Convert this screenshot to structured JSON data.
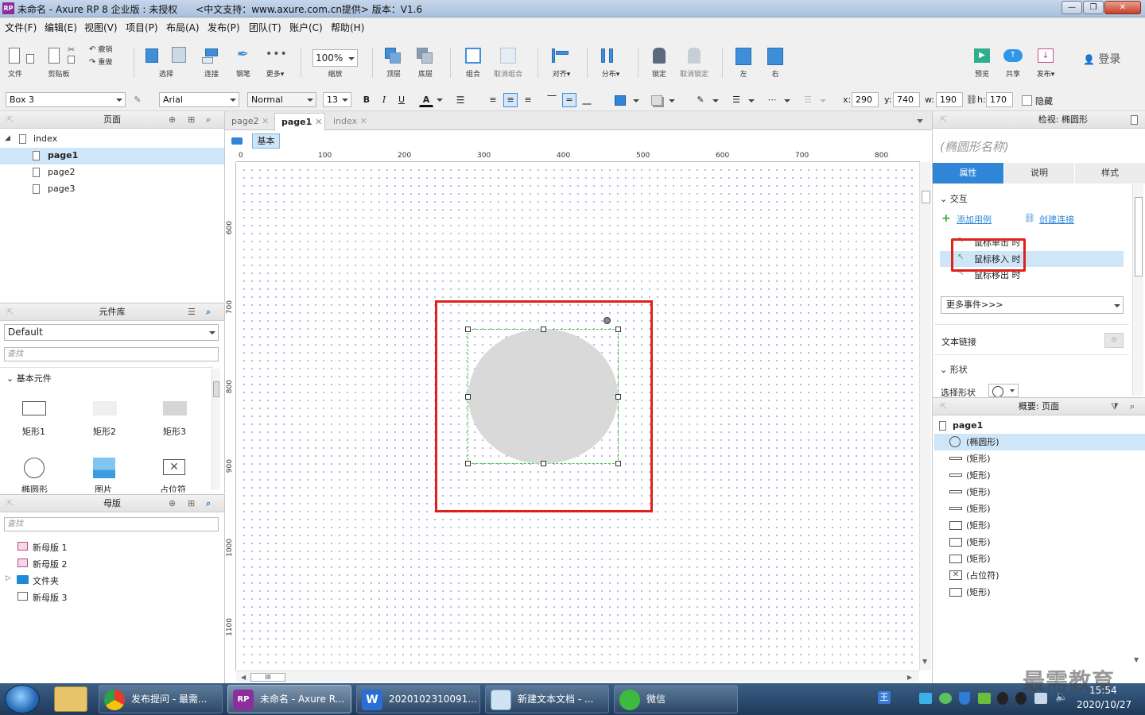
{
  "window": {
    "title": "未命名 - Axure RP 8 企业版 : 未授权      <中文支持：www.axure.com.cn提供> 版本：V1.6",
    "app_icon": "RP"
  },
  "menu": [
    "文件(F)",
    "编辑(E)",
    "视图(V)",
    "项目(P)",
    "布局(A)",
    "发布(P)",
    "团队(T)",
    "账户(C)",
    "帮助(H)"
  ],
  "toolbar": {
    "file": "文件",
    "clipboard": "剪贴板",
    "undo": "撤销",
    "redo": "重做",
    "select": "选择",
    "connect": "连接",
    "pen": "钢笔",
    "more": "更多▾",
    "zoom_value": "100%",
    "zoom_label": "缩放",
    "top": "顶层",
    "bottom": "底层",
    "group": "组合",
    "ungroup": "取消组合",
    "align": "对齐▾",
    "distribute": "分布▾",
    "lock": "锁定",
    "unlock": "取消锁定",
    "left": "左",
    "right": "右",
    "preview": "预览",
    "share": "共享",
    "publish": "发布▾",
    "login": "登录"
  },
  "formatbar": {
    "widget_name": "Box 3",
    "font": "Arial",
    "style": "Normal",
    "size": "13",
    "bold": "B",
    "italic": "I",
    "underline": "U",
    "font_color": "A",
    "x_label": "x:",
    "x": "290",
    "y_label": "y:",
    "y": "740",
    "w_label": "w:",
    "w": "190",
    "h_label": "h:",
    "h": "170",
    "hidden": "隐藏"
  },
  "pages_panel": {
    "title": "页面",
    "root": "index",
    "pages": [
      "page1",
      "page2",
      "page3"
    ]
  },
  "library_panel": {
    "title": "元件库",
    "selected": "Default",
    "search_placeholder": "查找",
    "category": "基本元件",
    "items": [
      "矩形1",
      "矩形2",
      "矩形3",
      "椭圆形",
      "图片",
      "占位符"
    ]
  },
  "masters_panel": {
    "title": "母版",
    "search_placeholder": "查找",
    "items": [
      "新母版 1",
      "新母版 2",
      "文件夹",
      "新母版 3"
    ]
  },
  "canvas": {
    "tabs": [
      "page2",
      "page1",
      "index"
    ],
    "active_tab": "page1",
    "adaptive_view": "基本",
    "h_ruler": [
      "0",
      "100",
      "200",
      "300",
      "400",
      "500",
      "600",
      "700",
      "800"
    ],
    "v_ruler": [
      "600",
      "700",
      "800",
      "900",
      "1000",
      "1100"
    ],
    "scroll_grip": "III"
  },
  "inspector": {
    "header": "检视: 椭圆形",
    "name_placeholder": "(椭圆形名称)",
    "tabs": [
      "属性",
      "说明",
      "样式"
    ],
    "interactions_title": "交互",
    "add_case": "添加用例",
    "create_link": "创建连接",
    "events": [
      "鼠标单击 时",
      "鼠标移入 时",
      "鼠标移出 时"
    ],
    "more_events": "更多事件>>>",
    "text_link": "文本链接",
    "shape_section": "形状",
    "select_shape": "选择形状"
  },
  "outline": {
    "header": "概要: 页面",
    "page": "page1",
    "items": [
      {
        "icon": "ellipse-icon",
        "label": "(椭圆形)"
      },
      {
        "icon": "line-rect-icon",
        "label": "(矩形)"
      },
      {
        "icon": "line-rect-icon",
        "label": "(矩形)"
      },
      {
        "icon": "line-rect-icon",
        "label": "(矩形)"
      },
      {
        "icon": "line-rect-icon",
        "label": "(矩形)"
      },
      {
        "icon": "rect-icon",
        "label": "(矩形)"
      },
      {
        "icon": "rect-icon",
        "label": "(矩形)"
      },
      {
        "icon": "rect-icon",
        "label": "(矩形)"
      },
      {
        "icon": "placeholder-icon",
        "label": "(占位符)"
      },
      {
        "icon": "rect-icon",
        "label": "(矩形)"
      }
    ]
  },
  "taskbar": {
    "items": [
      "发布提问 - 最需...",
      "未命名 - Axure R...",
      "2020102310091...",
      "新建文本文档 - ...",
      "微信"
    ],
    "clock_time": "15:54",
    "clock_date": "2020/10/27",
    "watermark": "最需教育"
  },
  "colors": {
    "accent": "#3e8ed9",
    "highlight_red": "#e0201b",
    "selection_green": "#3cc43c",
    "ellipse_fill": "#d9d9d9"
  }
}
